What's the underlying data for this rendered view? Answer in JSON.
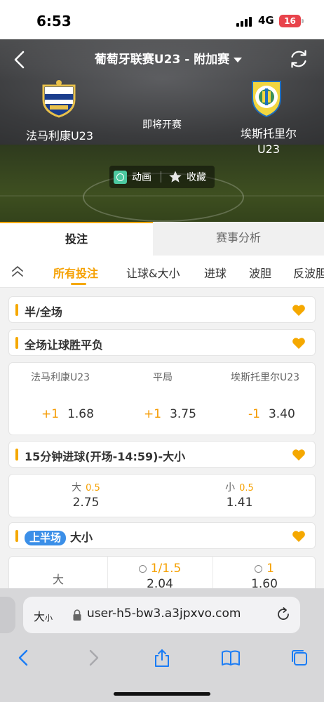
{
  "status_bar": {
    "time": "6:53",
    "network": "4G",
    "battery": "16"
  },
  "header": {
    "title": "葡萄牙联赛U23 - 附加赛",
    "home_team": "法马利康U23",
    "away_team_line1": "埃斯托里尔",
    "away_team_line2": "U23",
    "match_status": "即将开赛",
    "animation_label": "动画",
    "favorite_label": "收藏"
  },
  "tabs": {
    "bet": "投注",
    "analysis": "赛事分析"
  },
  "filters": [
    "所有投注",
    "让球&大小",
    "进球",
    "波胆",
    "反波胆"
  ],
  "markets": {
    "half_full": "半/全场",
    "full_handicap": "全场让球胜平负",
    "goals_15": "15分钟进球(开场-14:59)-大小",
    "first_half_badge": "上半场",
    "first_half_title": "大小"
  },
  "handicap_odds": {
    "home_label": "法马利康U23",
    "draw_label": "平局",
    "away_label": "埃斯托里尔U23",
    "home_hcp": "+1",
    "home_odds": "1.68",
    "draw_hcp": "+1",
    "draw_odds": "3.75",
    "away_hcp": "-1",
    "away_odds": "3.40"
  },
  "goals_odds": {
    "over_label": "大",
    "over_line": "0.5",
    "over_odds": "2.75",
    "under_label": "小",
    "under_line": "0.5",
    "under_odds": "1.41"
  },
  "first_half_odds": {
    "row_label": "大",
    "line1": "1/1.5",
    "odds1": "2.04",
    "line2": "1",
    "odds2": "1.60"
  },
  "browser": {
    "aa_big": "大",
    "aa_small": "小",
    "url": "user-h5-bw3.a3jpxvo.com"
  },
  "colors": {
    "accent": "#f5a800",
    "handicap": "#f59a00",
    "badge_blue": "#3b8fe8",
    "battery": "#e8434b"
  }
}
